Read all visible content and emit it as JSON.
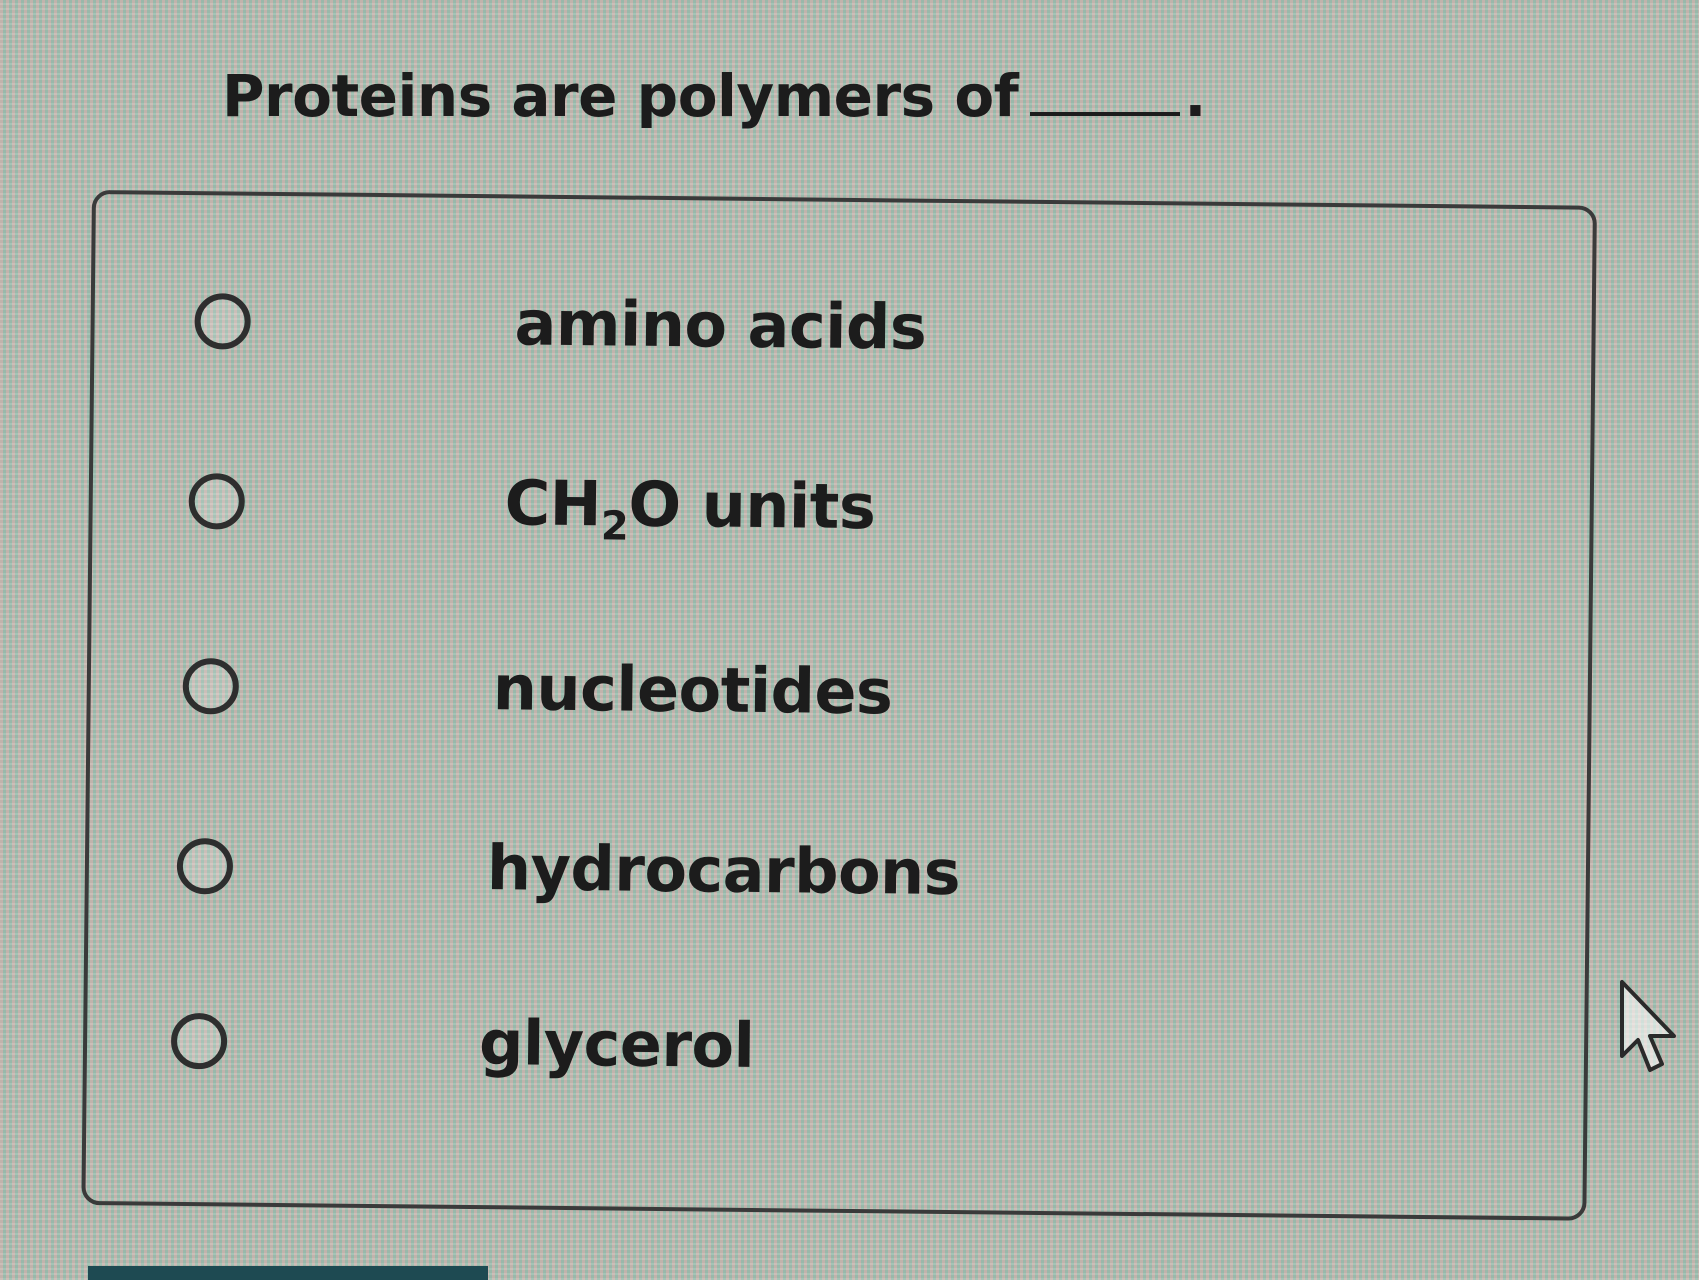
{
  "question": {
    "text": "Proteins are polymers of",
    "period": "."
  },
  "options": [
    {
      "label": "amino acids"
    },
    {
      "label_prefix": "CH",
      "label_sub": "2",
      "label_suffix": "O units"
    },
    {
      "label": "nucleotides"
    },
    {
      "label": "hydrocarbons"
    },
    {
      "label": "glycerol"
    }
  ]
}
